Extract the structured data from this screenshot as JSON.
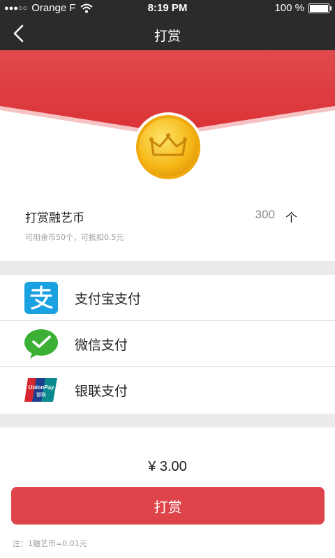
{
  "status_bar": {
    "signal": "●●●○○",
    "carrier": "Orange F",
    "time": "8:19 PM",
    "battery": "100 %",
    "icons": [
      "wifi-icon",
      "battery-icon"
    ]
  },
  "nav": {
    "title": "打赏",
    "back_icon": "chevron-left-icon"
  },
  "reward": {
    "title": "打赏融艺币",
    "amount": "300",
    "unit": "个",
    "note": "可用余币50个，可抵扣0.5元",
    "coin_icon": "crown-coin-icon"
  },
  "payment_methods": [
    {
      "label": "支付宝支付",
      "icon": "alipay-icon",
      "color": "#1aa1e2"
    },
    {
      "label": "微信支付",
      "icon": "wechat-pay-icon",
      "color": "#3cb034"
    },
    {
      "label": "银联支付",
      "icon": "unionpay-icon",
      "color": "#d6262f"
    }
  ],
  "total": "¥ 3.00",
  "submit_label": "打赏",
  "footnote": "注：1融艺币=0.01元",
  "colors": {
    "header_bg": "#2b2b2b",
    "accent_red": "#e0444b",
    "banner_red": "#e23c40",
    "separator": "#ebebeb"
  }
}
